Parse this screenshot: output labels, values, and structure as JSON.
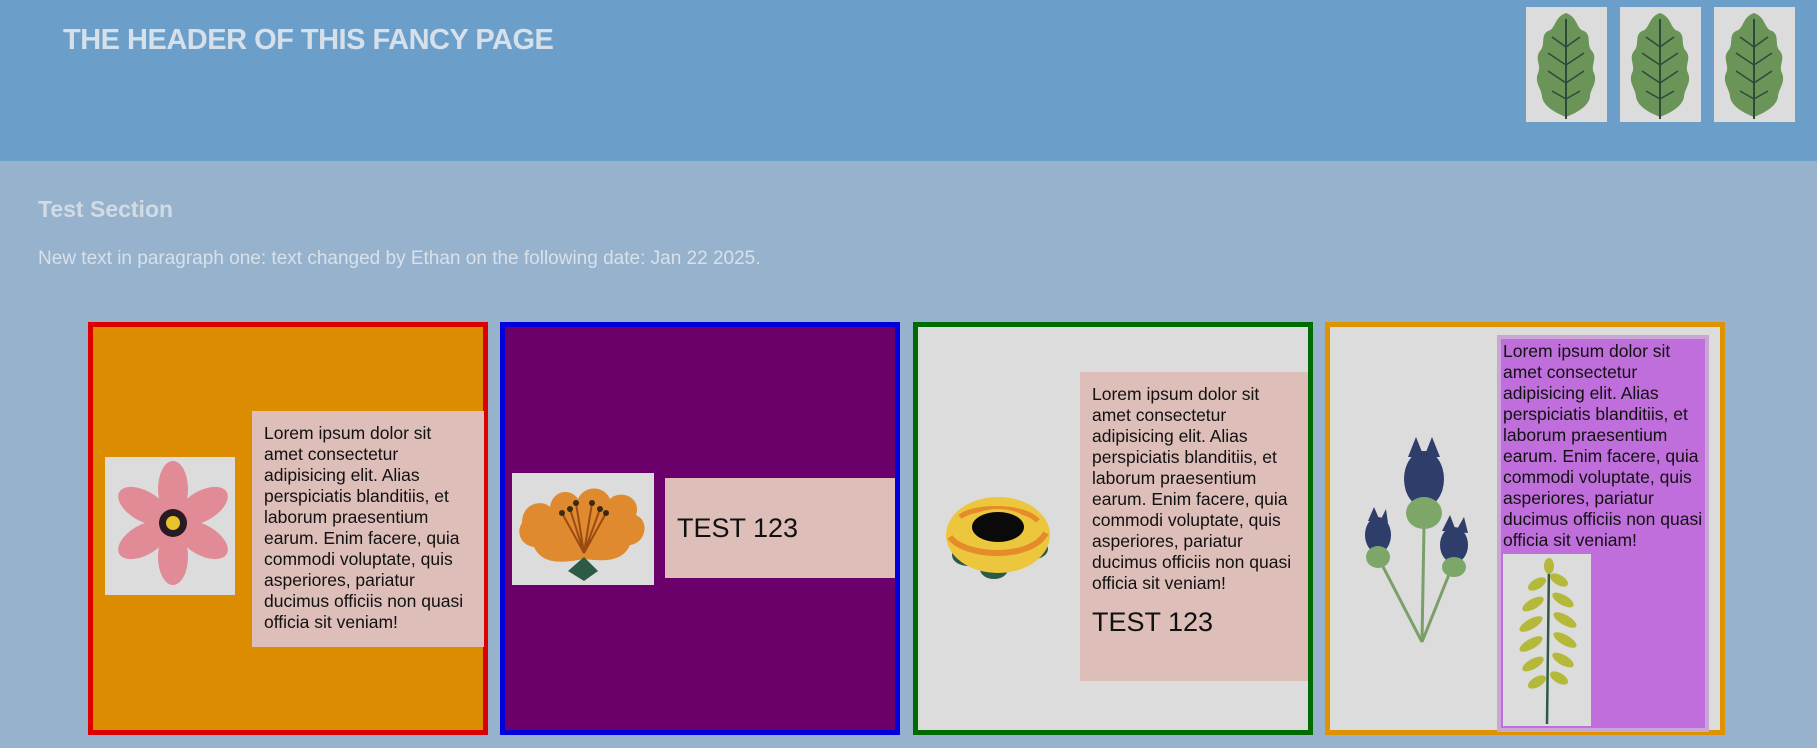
{
  "header": {
    "title": "THE HEADER OF THIS FANCY PAGE",
    "icons": [
      "leaf-icon",
      "leaf-icon",
      "leaf-icon"
    ]
  },
  "section": {
    "title": "Test Section",
    "paragraph": "New text in paragraph one: text changed by Ethan on the following date: Jan 22 2025."
  },
  "cards": [
    {
      "border_color": "#dd0000",
      "background": "#dc8c00",
      "icon": "pink-flower-icon",
      "text": "Lorem ipsum dolor sit amet consectetur adipisicing elit. Alias perspiciatis blanditiis, et laborum praesentium earum. Enim facere, quia commodi voluptate, quis asperiores, pariatur ducimus officiis non quasi officia sit veniam!"
    },
    {
      "border_color": "#0000dd",
      "background": "#6c006b",
      "icon": "orange-flower-icon",
      "label": "TEST 123"
    },
    {
      "border_color": "#006b00",
      "background": "#dcdcdc",
      "icon": "yellow-rose-icon",
      "text": "Lorem ipsum dolor sit amet consectetur adipisicing elit. Alias perspiciatis blanditiis, et laborum praesentium earum. Enim facere, quia commodi voluptate, quis asperiores, pariatur ducimus officiis non quasi officia sit veniam!",
      "label": "TEST 123"
    },
    {
      "border_color": "#de9300",
      "background": "#dcdcdc",
      "icon": "thistle-icon",
      "text": "Lorem ipsum dolor sit amet consectetur adipisicing elit. Alias perspiciatis blanditiis, et laborum praesentium earum. Enim facere, quia commodi voluptate, quis asperiores, pariatur ducimus officiis non quasi officia sit veniam!",
      "sub_icon": "fern-icon",
      "inner_background": "#c06edb"
    }
  ]
}
